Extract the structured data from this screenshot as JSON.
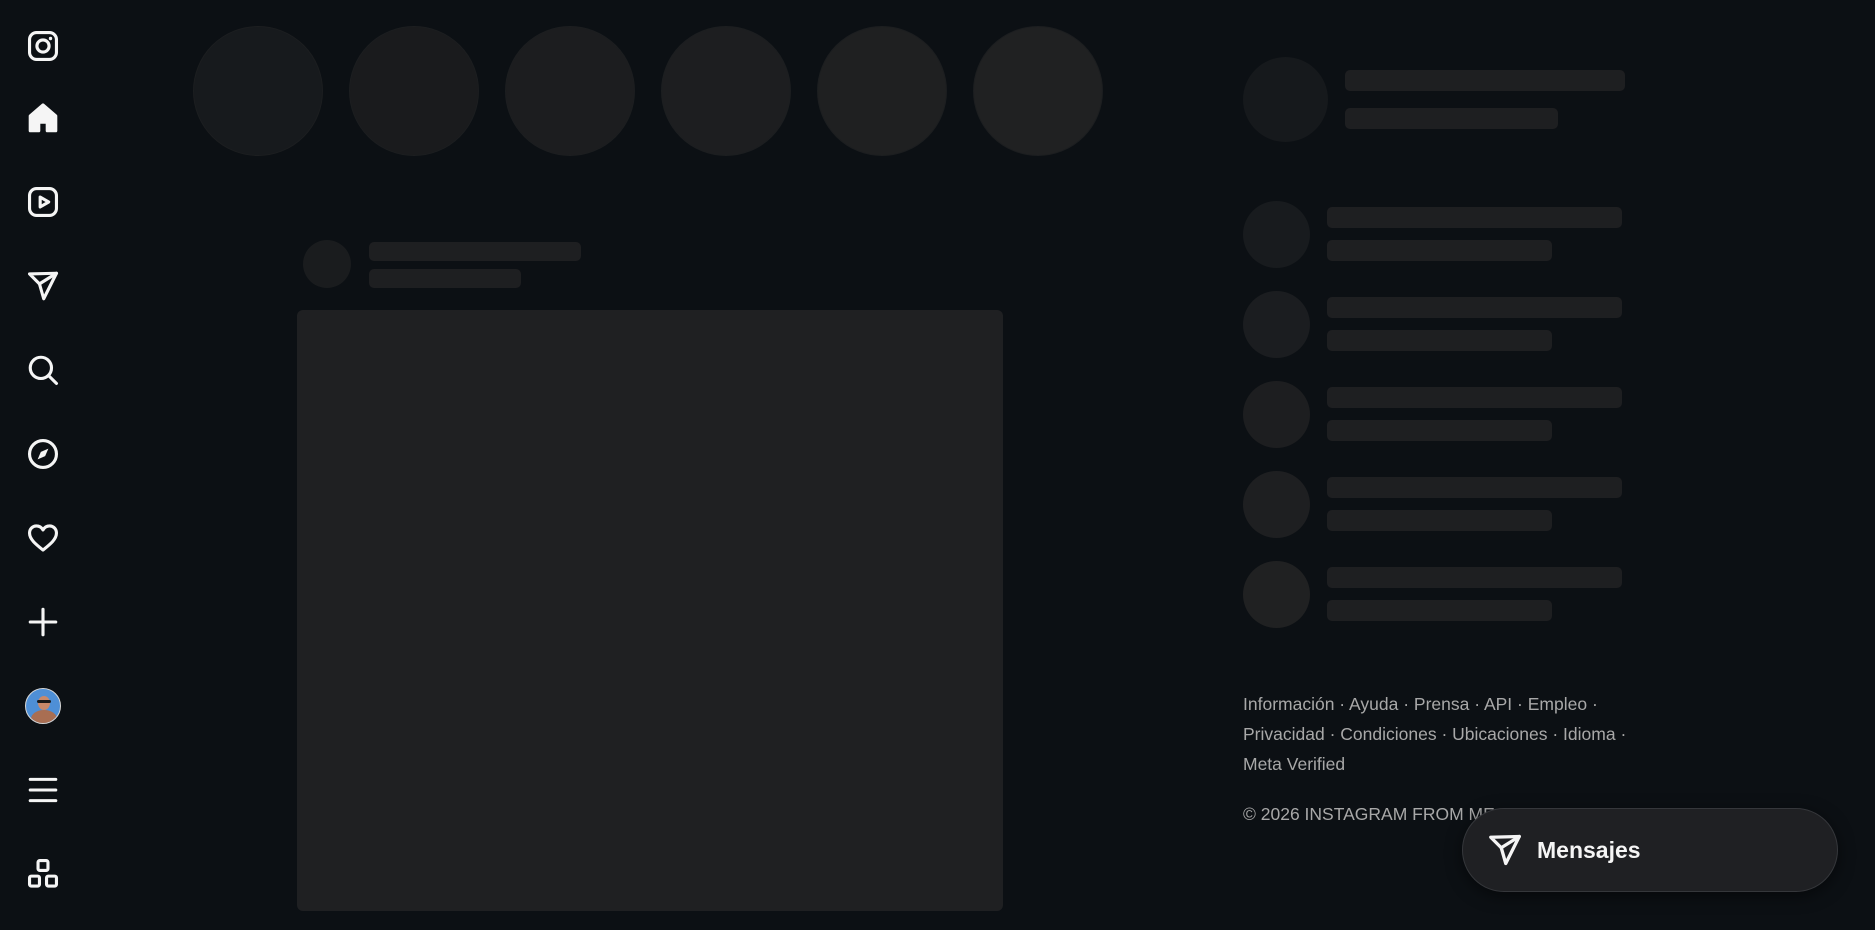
{
  "app": "Instagram",
  "sidebar": {
    "items": [
      {
        "name": "instagram-logo-icon"
      },
      {
        "name": "home-icon"
      },
      {
        "name": "reels-icon"
      },
      {
        "name": "direct-messages-icon"
      },
      {
        "name": "search-icon"
      },
      {
        "name": "explore-icon"
      },
      {
        "name": "notifications-heart-icon"
      },
      {
        "name": "create-plus-icon"
      },
      {
        "name": "profile-avatar"
      },
      {
        "name": "menu-icon"
      },
      {
        "name": "also-from-meta-icon"
      }
    ]
  },
  "footer": {
    "links": [
      "Información",
      "Ayuda",
      "Prensa",
      "API",
      "Empleo",
      "Privacidad",
      "Condiciones",
      "Ubicaciones",
      "Idioma",
      "Meta Verified"
    ],
    "separator": " · ",
    "copyright": "© 2026 INSTAGRAM FROM ME"
  },
  "messages": {
    "label": "Mensajes"
  },
  "colors": {
    "background": "#0c1014",
    "skeleton": "#1e1f21",
    "text_muted": "#a8a8a8",
    "text_primary": "#f5f5f5"
  }
}
